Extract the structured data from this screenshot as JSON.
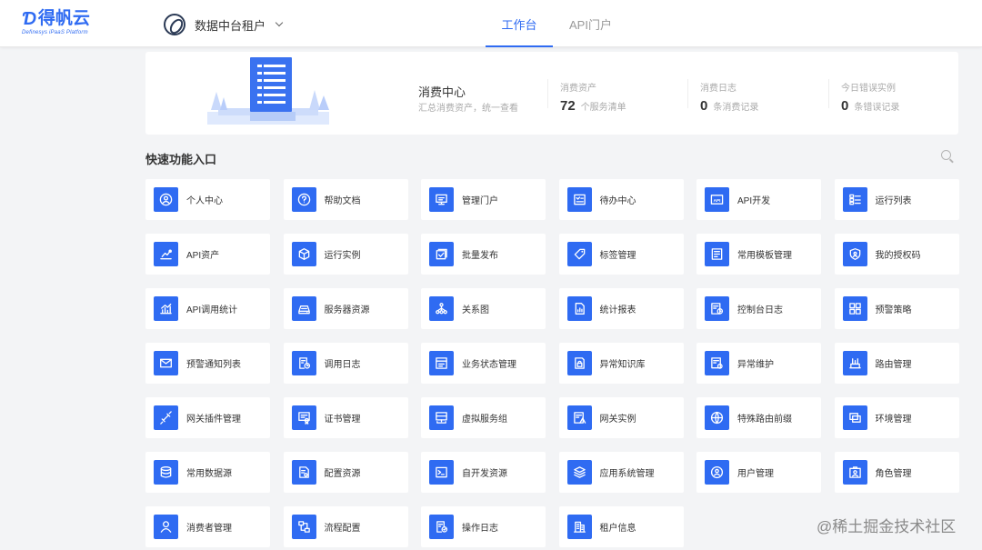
{
  "brand": {
    "name": "得帆云",
    "tagline": "Definesys iPaaS Platform",
    "color": "#2f6bf2"
  },
  "header": {
    "tenant_name": "数据中台租户",
    "tabs": [
      {
        "label": "工作台",
        "active": true
      },
      {
        "label": "API门户",
        "active": false
      }
    ]
  },
  "overview": {
    "title": "消费中心",
    "subtitle": "汇总消费资产，统一查看",
    "stats": [
      {
        "label": "消费资产",
        "value": "72",
        "unit": "个服务清单"
      },
      {
        "label": "消费日志",
        "value": "0",
        "unit": "条消费记录"
      },
      {
        "label": "今日错误实例",
        "value": "0",
        "unit": "条错误记录"
      }
    ]
  },
  "quick": {
    "title": "快速功能入口",
    "items": [
      {
        "label": "个人中心",
        "icon": "user-circle-icon"
      },
      {
        "label": "帮助文档",
        "icon": "help-icon"
      },
      {
        "label": "管理门户",
        "icon": "monitor-icon"
      },
      {
        "label": "待办中心",
        "icon": "todo-icon"
      },
      {
        "label": "API开发",
        "icon": "api-icon"
      },
      {
        "label": "运行列表",
        "icon": "list-icon"
      },
      {
        "label": "API资产",
        "icon": "api-asset-icon"
      },
      {
        "label": "运行实例",
        "icon": "cube-icon"
      },
      {
        "label": "批量发布",
        "icon": "batch-publish-icon"
      },
      {
        "label": "标签管理",
        "icon": "tag-icon"
      },
      {
        "label": "常用模板管理",
        "icon": "template-icon"
      },
      {
        "label": "我的授权码",
        "icon": "shield-icon"
      },
      {
        "label": "API调用统计",
        "icon": "chart-icon"
      },
      {
        "label": "服务器资源",
        "icon": "server-icon"
      },
      {
        "label": "关系图",
        "icon": "relation-icon"
      },
      {
        "label": "统计报表",
        "icon": "report-icon"
      },
      {
        "label": "控制台日志",
        "icon": "console-log-icon"
      },
      {
        "label": "预警策略",
        "icon": "grid-icon"
      },
      {
        "label": "预警通知列表",
        "icon": "mail-icon"
      },
      {
        "label": "调用日志",
        "icon": "call-log-icon"
      },
      {
        "label": "业务状态管理",
        "icon": "status-icon"
      },
      {
        "label": "异常知识库",
        "icon": "knowledge-icon"
      },
      {
        "label": "异常维护",
        "icon": "maintain-icon"
      },
      {
        "label": "路由管理",
        "icon": "route-icon"
      },
      {
        "label": "网关插件管理",
        "icon": "plugin-icon"
      },
      {
        "label": "证书管理",
        "icon": "certificate-icon"
      },
      {
        "label": "虚拟服务组",
        "icon": "virtual-group-icon"
      },
      {
        "label": "网关实例",
        "icon": "gateway-instance-icon"
      },
      {
        "label": "特殊路由前缀",
        "icon": "globe-icon"
      },
      {
        "label": "环境管理",
        "icon": "environment-icon"
      },
      {
        "label": "常用数据源",
        "icon": "database-icon"
      },
      {
        "label": "配置资源",
        "icon": "config-icon"
      },
      {
        "label": "自开发资源",
        "icon": "terminal-icon"
      },
      {
        "label": "应用系统管理",
        "icon": "layers-icon"
      },
      {
        "label": "用户管理",
        "icon": "user-manage-icon"
      },
      {
        "label": "角色管理",
        "icon": "role-icon"
      },
      {
        "label": "消费者管理",
        "icon": "consumer-icon"
      },
      {
        "label": "流程配置",
        "icon": "flow-icon"
      },
      {
        "label": "操作日志",
        "icon": "operation-log-icon"
      },
      {
        "label": "租户信息",
        "icon": "tenant-info-icon"
      }
    ]
  },
  "watermark": "@稀土掘金技术社区"
}
